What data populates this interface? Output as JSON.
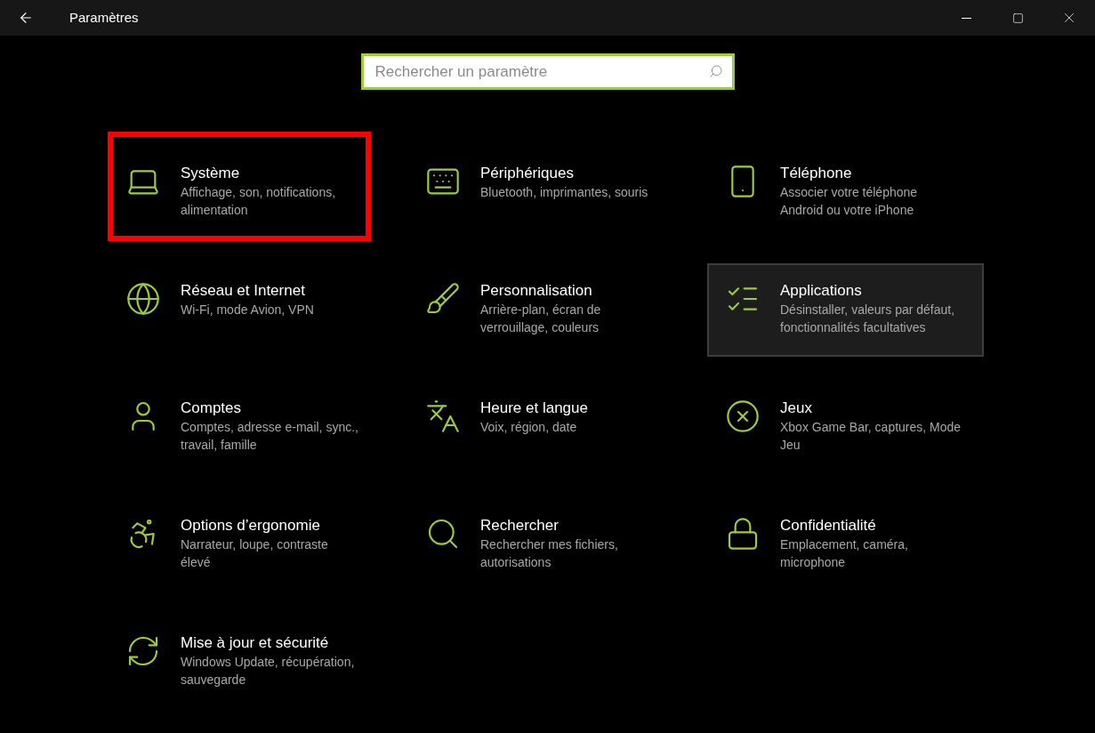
{
  "window": {
    "title": "Paramètres"
  },
  "search": {
    "placeholder": "Rechercher un paramètre"
  },
  "tiles": [
    {
      "title": "Système",
      "description_lines": [
        "Affichage, son, notifications,",
        "alimentation"
      ],
      "marked": true,
      "hovered": false
    },
    {
      "title": "Périphériques",
      "description_lines": [
        "Bluetooth, imprimantes, souris"
      ],
      "marked": false,
      "hovered": false
    },
    {
      "title": "Téléphone",
      "description_lines": [
        "Associer votre téléphone",
        "Android ou votre iPhone"
      ],
      "marked": false,
      "hovered": false
    },
    {
      "title": "Réseau et Internet",
      "description_lines": [
        "Wi-Fi, mode Avion, VPN"
      ],
      "marked": false,
      "hovered": false
    },
    {
      "title": "Personnalisation",
      "description_lines": [
        "Arrière-plan, écran de",
        "verrouillage, couleurs"
      ],
      "marked": false,
      "hovered": false
    },
    {
      "title": "Applications",
      "description_lines": [
        "Désinstaller, valeurs par défaut,",
        "fonctionnalités facultatives"
      ],
      "marked": false,
      "hovered": true
    },
    {
      "title": "Comptes",
      "description_lines": [
        "Comptes, adresse e-mail, sync.,",
        "travail, famille"
      ],
      "marked": false,
      "hovered": false
    },
    {
      "title": "Heure et langue",
      "description_lines": [
        "Voix, région, date"
      ],
      "marked": false,
      "hovered": false
    },
    {
      "title": "Jeux",
      "description_lines": [
        "Xbox Game Bar, captures, Mode",
        "Jeu"
      ],
      "marked": false,
      "hovered": false
    },
    {
      "title": "Options d’ergonomie",
      "description_lines": [
        "Narrateur, loupe, contraste",
        "élevé"
      ],
      "marked": false,
      "hovered": false
    },
    {
      "title": "Rechercher",
      "description_lines": [
        "Rechercher mes fichiers,",
        "autorisations"
      ],
      "marked": false,
      "hovered": false
    },
    {
      "title": "Confidentialité",
      "description_lines": [
        "Emplacement, caméra,",
        "microphone"
      ],
      "marked": false,
      "hovered": false
    },
    {
      "title": "Mise à jour et sécurité",
      "description_lines": [
        "Windows Update, récupération,",
        "sauvegarde"
      ],
      "marked": false,
      "hovered": false
    }
  ]
}
